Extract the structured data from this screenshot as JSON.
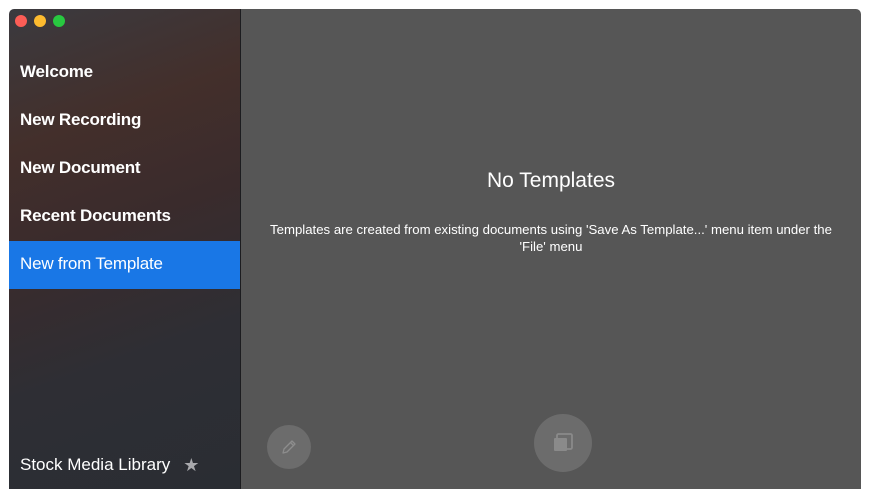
{
  "window": {
    "traffic_lights": {
      "close_color": "#fc5d56",
      "minimize_color": "#fdbb2f",
      "zoom_color": "#28c840"
    }
  },
  "sidebar": {
    "items": [
      {
        "label": "Welcome",
        "selected": false
      },
      {
        "label": "New Recording",
        "selected": false
      },
      {
        "label": "New Document",
        "selected": false
      },
      {
        "label": "Recent Documents",
        "selected": false
      },
      {
        "label": "New from Template",
        "selected": true
      }
    ],
    "footer": {
      "label": "Stock Media Library",
      "icon": "star-icon"
    },
    "accent_color": "#1977e6"
  },
  "main": {
    "empty_state": {
      "title": "No Templates",
      "description": "Templates are created from existing documents using 'Save As Template...' menu item under the 'File' menu"
    },
    "actions": {
      "edit_icon": "pencil-icon",
      "duplicate_icon": "duplicate-icon"
    }
  }
}
